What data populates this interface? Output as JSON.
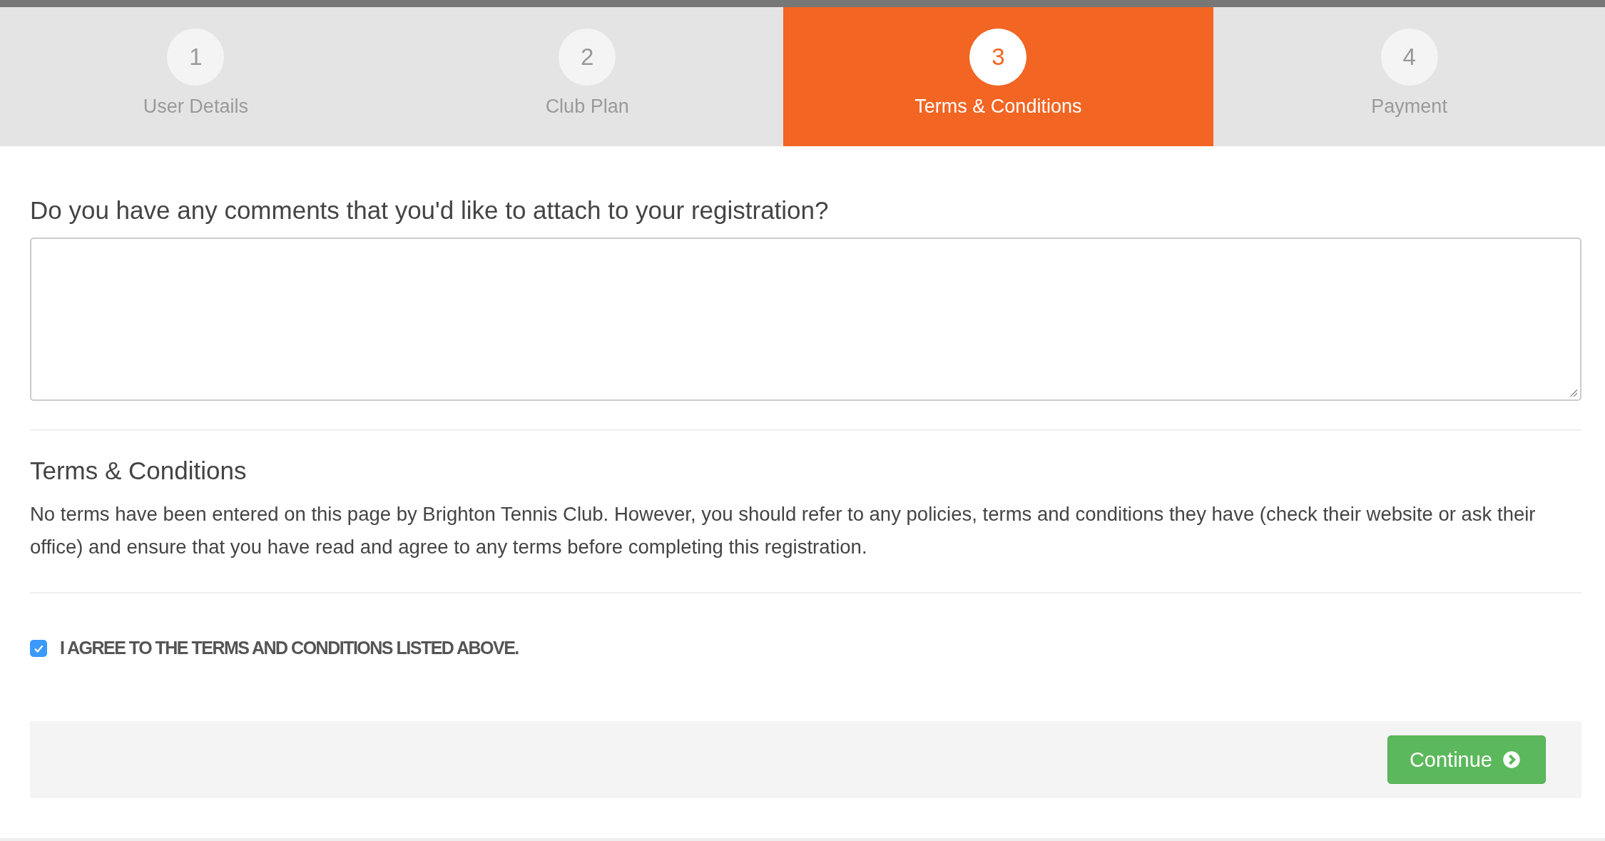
{
  "steps": [
    {
      "number": "1",
      "label": "User Details",
      "selected": false
    },
    {
      "number": "2",
      "label": "Club Plan",
      "selected": false
    },
    {
      "number": "3",
      "label": "Terms & Conditions",
      "selected": true
    },
    {
      "number": "4",
      "label": "Payment",
      "selected": false
    }
  ],
  "comments": {
    "question": "Do you have any comments that you'd like to attach to your registration?"
  },
  "terms": {
    "title": "Terms & Conditions",
    "text": "No terms have been entered on this page by Brighton Tennis Club. However, you should refer to any policies, terms and conditions they have (check their website or ask their office) and ensure that you have read and agree to any terms before completing this registration."
  },
  "agree": {
    "label": "I AGREE TO THE TERMS AND CONDITIONS LISTED ABOVE.",
    "checked": true
  },
  "footer": {
    "button": "Continue"
  }
}
